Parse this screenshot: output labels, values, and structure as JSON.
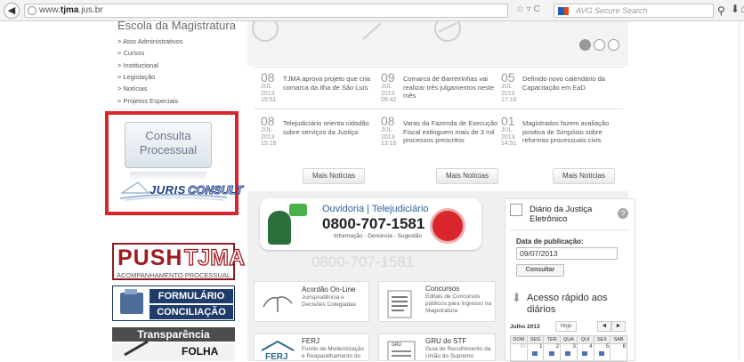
{
  "browser": {
    "url_prefix": "www.",
    "url_domain": "tjma",
    "url_suffix": ".jus.br",
    "search_placeholder": "AVG Secure Search",
    "url_icons": "☆ ▿ C"
  },
  "left": {
    "escola_title": "Escola da Magistratura",
    "menu": [
      "> Atos Administrativos",
      "> Cursos",
      "> Institucional",
      "> Legislação",
      "> Notícias",
      "> Projetos Especiais"
    ],
    "consulta_line1": "Consulta",
    "consulta_line2": "Processual",
    "juris": "JURIS",
    "consult": "CONSULT",
    "push_word": "PUSH",
    "push_tjma": "TJMA",
    "push_sub": "ACOMPANHAMENTO PROCESSUAL",
    "form_line1": "FORMULÁRIO",
    "form_line2": "CONCILIAÇÃO",
    "transparencia": "Transparência",
    "folha": "FOLHA"
  },
  "news": [
    {
      "day": "08",
      "month": "JUL",
      "year": "2013",
      "time": "15:51",
      "text": "TJMA aprova projeto que cria comarca da Ilha de São Luís"
    },
    {
      "day": "09",
      "month": "JUL",
      "year": "2013",
      "time": "09:42",
      "text": "Comarca de Barreirinhas vai realizar três julgamentos neste mês"
    },
    {
      "day": "05",
      "month": "JUL",
      "year": "2013",
      "time": "17:16",
      "text": "Definido novo calendário da Capacitação em EaD"
    },
    {
      "day": "08",
      "month": "JUL",
      "year": "2013",
      "time": "15:16",
      "text": "Telejudiciário orienta cidadão sobre serviços da Justiça"
    },
    {
      "day": "08",
      "month": "JUL",
      "year": "2013",
      "time": "13:16",
      "text": "Varas da Fazenda de Execução Fiscal extinguem mais de 3 mil processos prescritos"
    },
    {
      "day": "01",
      "month": "JUL",
      "year": "2013",
      "time": "14:51",
      "text": "Magistrados fazem avaliação positiva de Simpósio sobre reformas processuais civis"
    }
  ],
  "mais_noticias": "Mais Notícias",
  "ouvidoria": {
    "title": "Ouvidoria  |  Telejudiciário",
    "phone": "0800-707-1581",
    "sub": "Informação - Denúncia - Sugestão",
    "ghost": "0800-707-1581"
  },
  "cards": [
    {
      "title": "Acordão On-Line",
      "sub": "Jurisprudência e Decisões Colegiadas"
    },
    {
      "title": "Concursos",
      "sub": "Editais de Concursos públicos para ingresso na Magistratura"
    },
    {
      "title": "FERJ",
      "sub": "Fundo de Modernização e Reaparelhamento do"
    },
    {
      "title": "GRU do STF",
      "sub": "Guia de Recolhimento da União do Supremo"
    }
  ],
  "ferj_logo": "FERJ",
  "gru_logo": "GRU",
  "diario": {
    "title": "Diário da Justiça Eletrônico",
    "help": "?",
    "pub_label": "Data de publicação:",
    "date_value": "09/07/2013",
    "button": "Consultar",
    "acesso": "Acesso rápido aos diários",
    "month": "Julho 2013",
    "hoje": "Hoje",
    "prev": "◄",
    "next": "►",
    "weekdays": [
      "DOM",
      "SEG",
      "TER",
      "QUA",
      "QUI",
      "SEX",
      "SAB"
    ],
    "week1": [
      "30",
      "1",
      "2",
      "3",
      "4",
      "5",
      "6"
    ]
  }
}
